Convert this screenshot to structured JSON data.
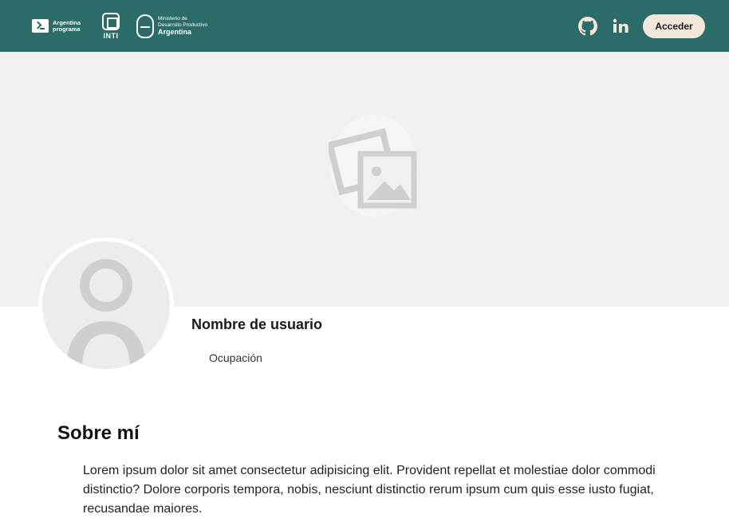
{
  "header": {
    "brand_programa": "Argentina programa",
    "brand_inti": "INTI",
    "brand_ministerio_line1": "Ministerio de",
    "brand_ministerio_line2": "Desarrollo Productivo",
    "brand_ministerio_line3": "Argentina",
    "social_icons": [
      "github-icon",
      "linkedin-icon"
    ],
    "login_label": "Acceder",
    "background_color": "#2b6b68",
    "login_button_color": "#f1e8db"
  },
  "cover": {
    "icon": "image-placeholder-icon",
    "background_color": "#f0f0f1"
  },
  "profile": {
    "avatar_icon": "user-placeholder-icon",
    "username": "Nombre de usuario",
    "occupation": "Ocupación"
  },
  "about": {
    "title": "Sobre mí",
    "text": "Lorem ipsum dolor sit amet consectetur adipisicing elit. Provident repellat et molestiae dolor commodi distinctio? Dolore corporis tempora, nobis, nesciunt distinctio rerum ipsum cum quis esse iusto fugiat, recusandae maiores."
  }
}
